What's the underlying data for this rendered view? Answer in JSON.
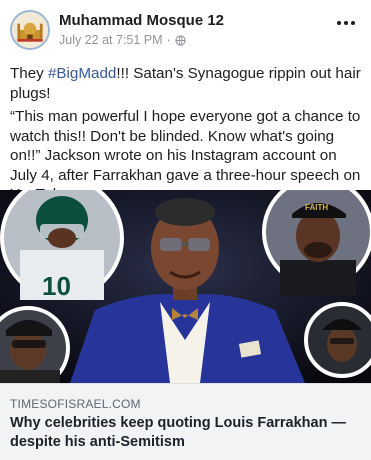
{
  "post": {
    "author": "Muhammad Mosque 12",
    "timestamp": "July 22 at 7:51 PM",
    "separator": "·",
    "privacy_icon": "globe-icon",
    "more_icon": "ellipsis-icon"
  },
  "body": {
    "line1_prefix": "They ",
    "hashtag": "#BigMadd",
    "line1_suffix": "!!! Satan's Synagogue rippin out hair plugs!",
    "paragraph2": "“This man powerful I hope everyone got a chance to watch this!! Don't be blinded. Know what's going on!!” Jackson wrote on his Instagram account on July 4, after Farrakhan gave a three-hour speech on YouTube."
  },
  "image": {
    "jersey_text": "FAITH"
  },
  "link": {
    "domain": "TIMESOFISRAEL.COM",
    "title": "Why celebrities keep quoting Louis Farrakhan — despite his anti-Semitism"
  },
  "colors": {
    "hashtag": "#385898",
    "card_bg": "#f2f3f5",
    "meta_text": "#90949c"
  }
}
